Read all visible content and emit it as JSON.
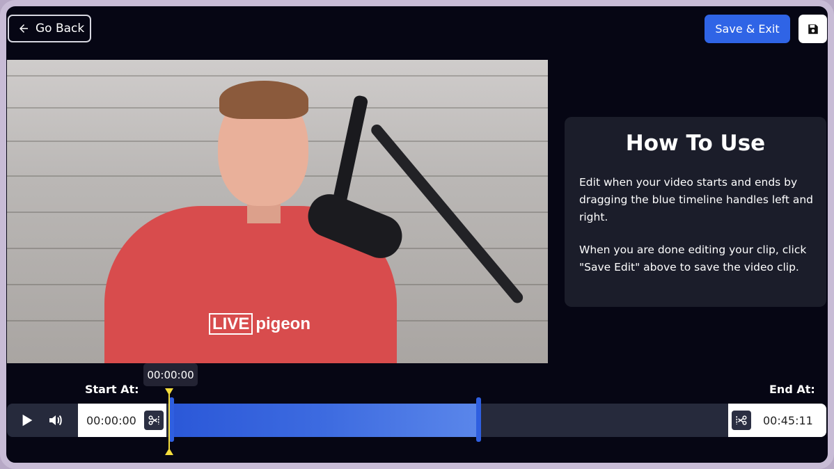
{
  "header": {
    "back_label": "Go Back",
    "save_exit_label": "Save & Exit"
  },
  "video": {
    "shirt_logo_box": "LIVE",
    "shirt_logo_rest": "pigeon"
  },
  "howto": {
    "title": "How To Use",
    "paragraph1": "Edit when your video starts and ends by dragging the blue timeline handles left and right.",
    "paragraph2": "When you are done editing your clip, click \"Save Edit\" above to save the video clip."
  },
  "timeline": {
    "start_label": "Start At:",
    "end_label": "End At:",
    "tooltip_time": "00:00:00",
    "start_time": "00:00:00",
    "end_time": "00:45:11",
    "playhead_fraction": 0.0,
    "selection_start_fraction": 0.0,
    "selection_end_fraction": 0.55
  },
  "colors": {
    "accent": "#2f64e6",
    "background": "#060614",
    "playhead": "#f4dd3c"
  },
  "icons": [
    "arrow-left-icon",
    "floppy-disk-icon",
    "play-icon",
    "volume-icon",
    "scissors-icon"
  ]
}
